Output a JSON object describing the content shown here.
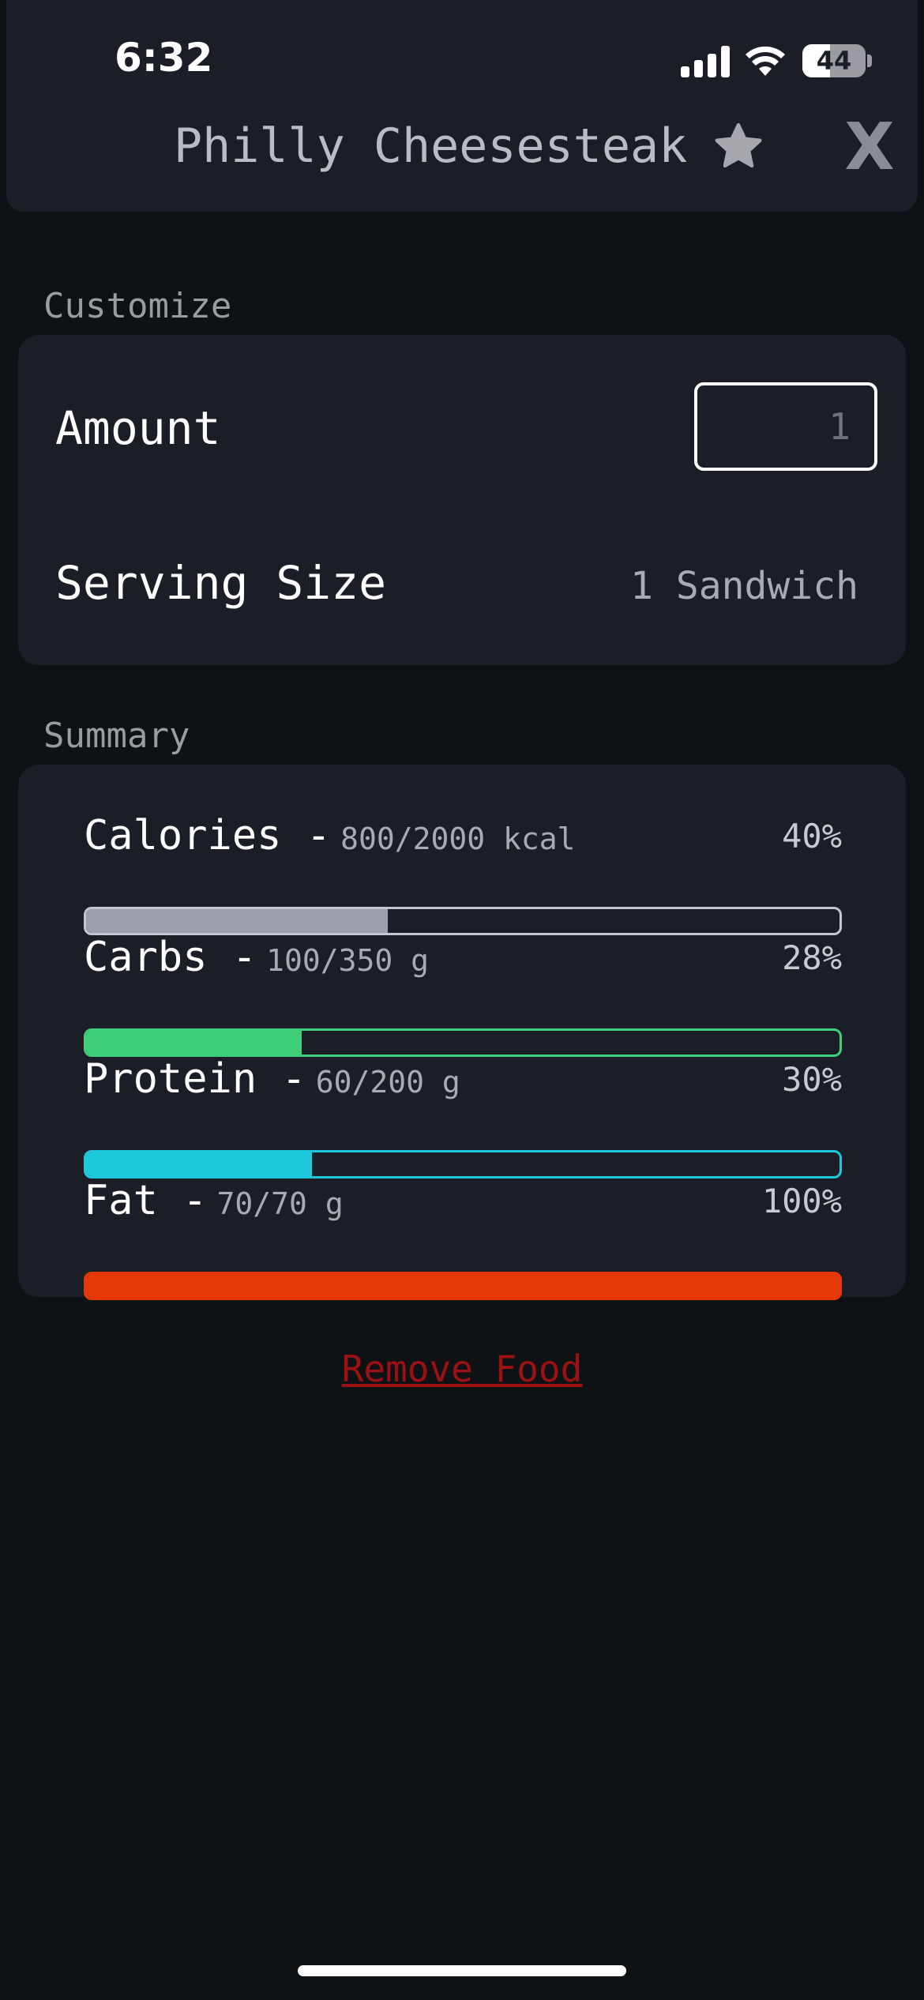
{
  "status_bar": {
    "time": "6:32",
    "battery": "44",
    "battery_level": 0.44
  },
  "header": {
    "title": "Philly Cheesesteak",
    "favorite_icon": "star-icon",
    "close_label": "X"
  },
  "customize": {
    "label": "Customize",
    "amount_label": "Amount",
    "amount_placeholder": "1",
    "serving_label": "Serving Size",
    "serving_value": "1 Sandwich"
  },
  "summary": {
    "label": "Summary",
    "macros": [
      {
        "name": "Calories -",
        "amount": "800/2000 kcal",
        "percent": "40%",
        "fraction": 0.4,
        "fill": "#9c9eab",
        "border": "#c3c5cf"
      },
      {
        "name": "Carbs -",
        "amount": "100/350 g",
        "percent": "28%",
        "fraction": 0.286,
        "fill": "#3ecf78",
        "border": "#3ecf78"
      },
      {
        "name": "Protein -",
        "amount": "60/200 g",
        "percent": "30%",
        "fraction": 0.3,
        "fill": "#1ec8dc",
        "border": "#1ec8dc"
      },
      {
        "name": "Fat -",
        "amount": "70/70 g",
        "percent": "100%",
        "fraction": 1.0,
        "fill": "#e6390a",
        "border": "#e6390a"
      }
    ]
  },
  "actions": {
    "remove_label": "Remove Food"
  }
}
